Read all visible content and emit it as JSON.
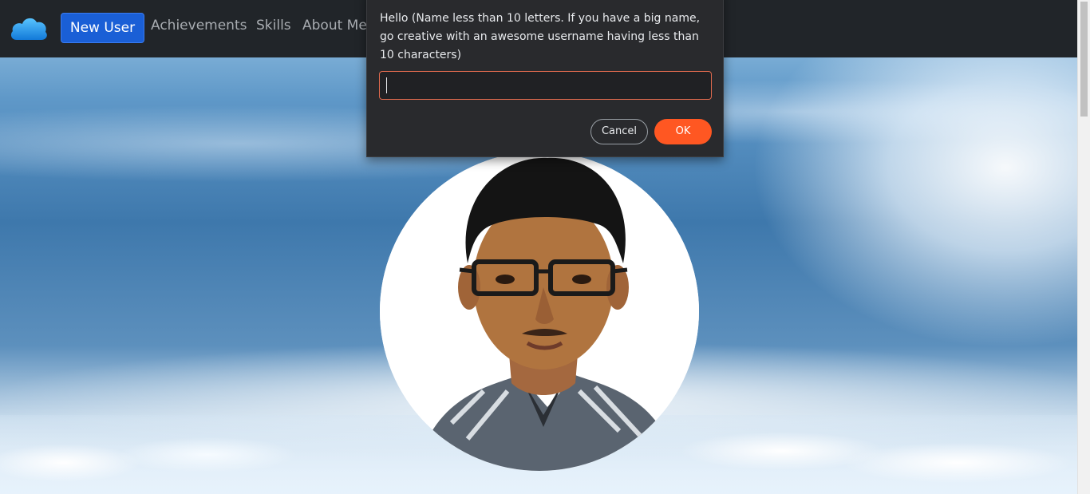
{
  "navbar": {
    "logo_icon": "cloud-icon",
    "new_user_label": "New User",
    "links": [
      "Achievements",
      "Skills",
      "About Me"
    ]
  },
  "hero": {
    "profile_photo": "profile-photo"
  },
  "dialog": {
    "message": "Hello (Name less than 10 letters. If you have a big name, go creative with an awesome username having less than 10 characters)",
    "input_value": "",
    "cancel_label": "Cancel",
    "ok_label": "OK"
  },
  "colors": {
    "navbar_bg": "#212529",
    "primary_button": "#1a5fd6",
    "ok_button": "#ff5722",
    "dialog_bg": "#292a2d"
  }
}
